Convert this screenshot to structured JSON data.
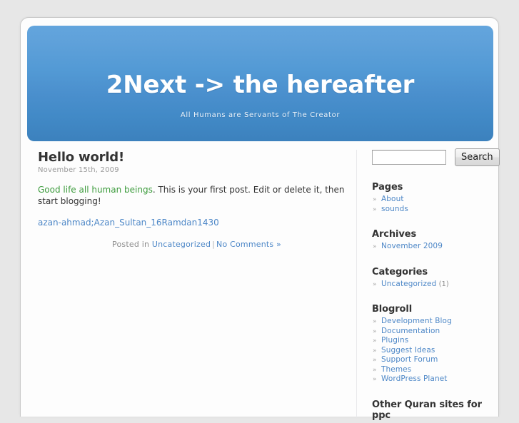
{
  "header": {
    "title": "2Next -> the hereafter",
    "description": "All Humans are Servants of The Creator"
  },
  "post": {
    "title": "Hello world!",
    "date": "November 15th, 2009",
    "lede": "Good life all human beings",
    "body": ".  This is your first post. Edit or delete it, then start blogging!",
    "attachment_link": "azan-ahmad;Azan_Sultan_16Ramdan1430",
    "meta": {
      "posted_in_label": "Posted in",
      "category": "Uncategorized",
      "separator": "|",
      "comments": "No Comments »"
    }
  },
  "sidebar": {
    "search": {
      "value": "",
      "placeholder": "",
      "button_label": "Search"
    },
    "widgets": [
      {
        "title": "Pages",
        "items": [
          {
            "label": "About",
            "count": ""
          },
          {
            "label": "sounds",
            "count": ""
          }
        ]
      },
      {
        "title": "Archives",
        "items": [
          {
            "label": "November 2009",
            "count": ""
          }
        ]
      },
      {
        "title": "Categories",
        "items": [
          {
            "label": "Uncategorized",
            "count": "(1)"
          }
        ]
      },
      {
        "title": "Blogroll",
        "items": [
          {
            "label": "Development Blog",
            "count": ""
          },
          {
            "label": "Documentation",
            "count": ""
          },
          {
            "label": "Plugins",
            "count": ""
          },
          {
            "label": "Suggest Ideas",
            "count": ""
          },
          {
            "label": "Support Forum",
            "count": ""
          },
          {
            "label": "Themes",
            "count": ""
          },
          {
            "label": "WordPress Planet",
            "count": ""
          }
        ]
      },
      {
        "title": "Other Quran sites for ppc",
        "items": []
      }
    ]
  },
  "colors": {
    "page_background": "#e7e7e7",
    "header_gradient_top": "#63a5dd",
    "header_gradient_bottom": "#3c81bd",
    "link": "#4d87c7",
    "lede_green": "#3d9c3d",
    "text": "#333333",
    "muted": "#9a9a9a"
  }
}
